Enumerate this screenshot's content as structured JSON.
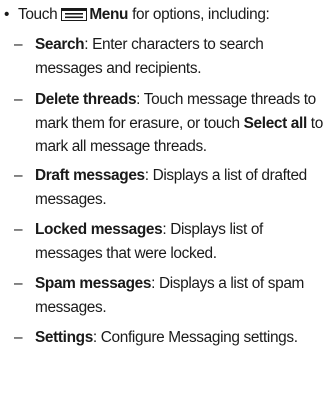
{
  "intro": {
    "bullet": "•",
    "prefix": "Touch",
    "menu_label": "Menu",
    "suffix": "for options, including:"
  },
  "items": [
    {
      "dash": "–",
      "term": "Search",
      "rest": ": Enter characters to search messages and recipients."
    },
    {
      "dash": "–",
      "term": "Delete threads",
      "middle": ": Touch message threads to mark them for erasure, or touch ",
      "term2": "Select all",
      "rest": " to mark all message threads."
    },
    {
      "dash": "–",
      "term": "Draft messages",
      "rest": ": Displays a list of drafted messages."
    },
    {
      "dash": "–",
      "term": "Locked messages",
      "rest": ": Displays list of messages that were locked."
    },
    {
      "dash": "–",
      "term": "Spam messages",
      "rest": ": Displays a list of spam messages."
    },
    {
      "dash": "–",
      "term": "Settings",
      "rest": ": Configure Messaging settings."
    }
  ]
}
